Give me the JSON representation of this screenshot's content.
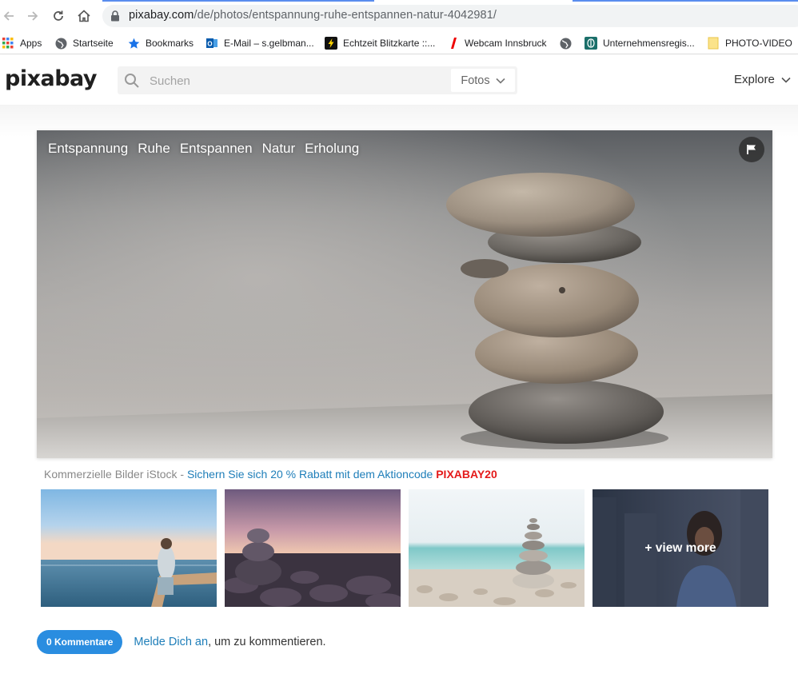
{
  "browser": {
    "url_domain": "pixabay.com",
    "url_path": "/de/photos/entspannung-ruhe-entspannen-natur-4042981/",
    "bookmarks": [
      {
        "label": "Apps",
        "icon": "apps-grid-icon"
      },
      {
        "label": "Startseite",
        "icon": "globe-icon"
      },
      {
        "label": "Bookmarks",
        "icon": "star-icon"
      },
      {
        "label": "E-Mail – s.gelbman...",
        "icon": "outlook-icon"
      },
      {
        "label": "Echtzeit Blitzkarte ::...",
        "icon": "lightning-icon"
      },
      {
        "label": "Webcam Innsbruck",
        "icon": "red-slash-icon"
      },
      {
        "label": "",
        "icon": "globe-icon"
      },
      {
        "label": "Unternehmensregis...",
        "icon": "register-icon"
      },
      {
        "label": "PHOTO-VIDEO",
        "icon": "folder-icon"
      }
    ]
  },
  "header": {
    "logo": "pixabay",
    "search_placeholder": "Suchen",
    "search_type": "Fotos",
    "explore": "Explore"
  },
  "hero": {
    "tags": [
      "Entspannung",
      "Ruhe",
      "Entspannen",
      "Natur",
      "Erholung"
    ]
  },
  "promo": {
    "prefix": "Kommerzielle Bilder iStock - ",
    "offer": "Sichern Sie sich 20 % Rabatt mit dem Aktioncode ",
    "code": "PIXABAY20"
  },
  "thumbs": {
    "view_more": "+ view more"
  },
  "comments": {
    "button": "0 Kommentare",
    "login_link": "Melde Dich an",
    "suffix": ", um zu kommentieren."
  },
  "colors": {
    "accent_blue": "#2a8de0",
    "link_blue": "#1e7eb9",
    "promo_red": "#e41a1a"
  }
}
